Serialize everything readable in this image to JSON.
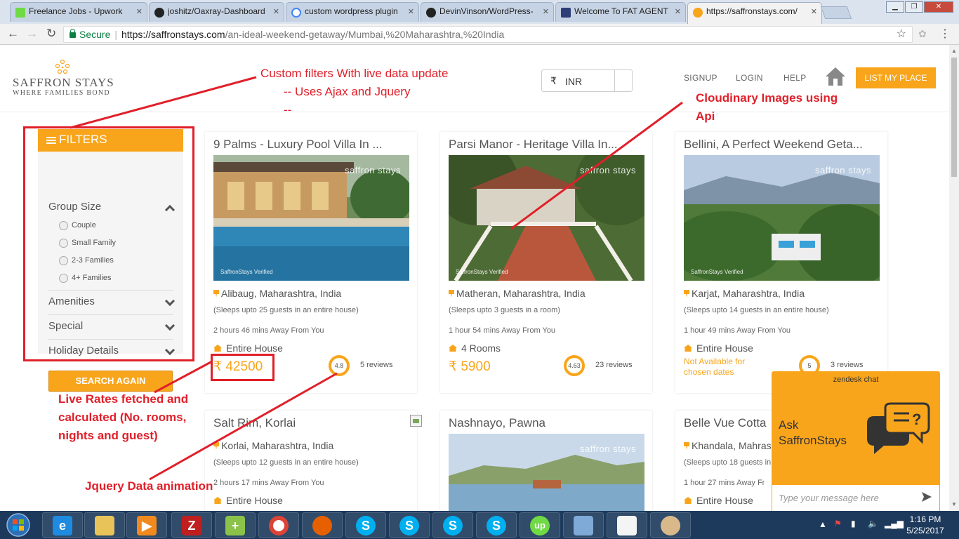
{
  "browser": {
    "tabs": [
      {
        "label": "Freelance Jobs - Upwork",
        "icon": "upwork-icon",
        "color": "#6fda44"
      },
      {
        "label": "joshitz/Oaxray-Dashboard",
        "icon": "github-icon",
        "color": "#222222"
      },
      {
        "label": "custom wordpress plugin",
        "icon": "google-icon",
        "color": "#4285f4"
      },
      {
        "label": "DevinVinson/WordPress-",
        "icon": "github-icon",
        "color": "#222222"
      },
      {
        "label": "Welcome To FAT AGENT",
        "icon": "fatagent-icon",
        "color": "#2c3e75"
      },
      {
        "label": "https://saffronstays.com/",
        "icon": "saffronstays-icon",
        "color": "#f8a51b"
      }
    ],
    "secure_label": "Secure",
    "url_host": "https://saffronstays.com",
    "url_path": "/an-ideal-weekend-getaway/Mumbai,%20Maharashtra,%20India"
  },
  "header": {
    "logo_title": "SAFFRON STAYS",
    "logo_tagline": "WHERE FAMILIES BOND",
    "currency_symbol": "₹",
    "currency_value": "INR",
    "nav": [
      "SIGNUP",
      "LOGIN",
      "HELP"
    ],
    "list_button": "LIST MY PLACE"
  },
  "annotations": {
    "filters_title": "Custom filters With live data update",
    "filters_sub": "-- Uses Ajax and Jquery",
    "filters_sub2": "--",
    "cloudinary_line1": "Cloudinary Images using",
    "cloudinary_line2": "Api",
    "live_rates_1": "Live Rates fetched and",
    "live_rates_2": "calculated (No. rooms,",
    "live_rates_3": "nights and guest)",
    "jquery_anim": "Jquery Data animation"
  },
  "filters": {
    "title": "FILTERS",
    "group_size": "Group Size",
    "options": [
      "Couple",
      "Small Family",
      "2-3 Families",
      "4+ Families"
    ],
    "amenities": "Amenities",
    "special": "Special",
    "holiday": "Holiday Details",
    "search_again": "SEARCH AGAIN"
  },
  "listings": [
    {
      "title": "9 Palms - Luxury Pool Villa In ...",
      "location": "Alibaug, Maharashtra, India",
      "sleeps": "(Sleeps upto 25 guests in an entire house)",
      "away": "2 hours 46 mins Away From You",
      "type": "Entire House",
      "price": "₹ 42500",
      "rating": "4.8",
      "reviews": "5 reviews",
      "watermark": "saffron stays",
      "verified": "SaffronStays Verified"
    },
    {
      "title": "Parsi Manor - Heritage Villa In...",
      "location": "Matheran, Maharashtra, India",
      "sleeps": "(Sleeps upto 3 guests in a room)",
      "away": "1 hour 54 mins Away From You",
      "type": "4 Rooms",
      "price": "₹ 5900",
      "rating": "4.63",
      "reviews": "23 reviews",
      "watermark": "saffron stays",
      "verified": "SaffronStays Verified"
    },
    {
      "title": "Bellini, A Perfect Weekend Geta...",
      "location": "Karjat, Maharashtra, India",
      "sleeps": "(Sleeps upto 14 guests in an entire house)",
      "away": "1 hour 49 mins Away From You",
      "type": "Entire House",
      "not_available_1": "Not Available for",
      "not_available_2": "chosen dates",
      "rating": "5",
      "reviews": "3 reviews",
      "watermark": "saffron stays",
      "verified": "SaffronStays Verified"
    },
    {
      "title": "Salt Rim, Korlai",
      "location": "Korlai, Maharashtra, India",
      "sleeps": "(Sleeps upto 12 guests in an entire house)",
      "away": "2 hours 17 mins Away From You",
      "type": "Entire House"
    },
    {
      "title": "Nashnayo, Pawna",
      "watermark": "saffron stays"
    },
    {
      "title": "Belle Vue Cotta",
      "location": "Khandala, Mahras",
      "sleeps": "(Sleeps upto 18 guests in",
      "away": "1 hour 27 mins Away Fr",
      "type": "Entire House"
    }
  ],
  "chat": {
    "header": "zendesk chat",
    "ask_1": "Ask",
    "ask_2": "SaffronStays",
    "placeholder": "Type your message here"
  },
  "taskbar": {
    "time": "1:16 PM",
    "date": "5/25/2017",
    "apps": [
      "ie-icon",
      "explorer-icon",
      "media-player-icon",
      "filezilla-icon",
      "notepad-plus-icon",
      "chrome-icon",
      "firefox-icon",
      "skype-icon",
      "skype-icon",
      "skype-icon",
      "skype-icon",
      "upwork-icon",
      "virtualbox-icon",
      "notepad-icon",
      "paint-icon"
    ]
  },
  "colors": {
    "brand": "#f8a51b",
    "annotation": "#e0202a",
    "secure": "#0b8043"
  }
}
